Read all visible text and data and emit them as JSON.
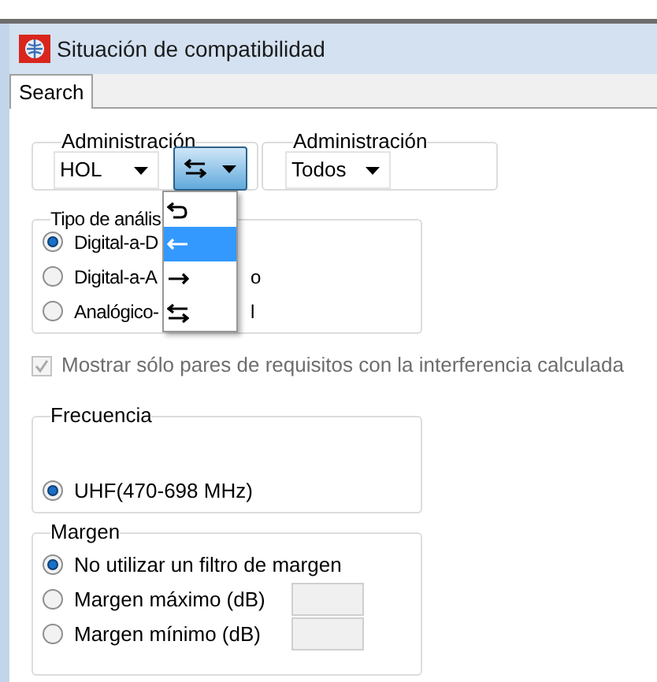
{
  "window": {
    "title": "Situación de compatibilidad"
  },
  "tabs": [
    {
      "label": "Search",
      "selected": true
    }
  ],
  "admin_groups": [
    {
      "label": "Administración",
      "value": "HOL"
    },
    {
      "label": "Administración",
      "value": "Todos"
    }
  ],
  "direction_combo": {
    "kind": "swap",
    "expanded": true,
    "options": [
      {
        "kind": "undo",
        "selected": false
      },
      {
        "kind": "left",
        "selected": true
      },
      {
        "kind": "right",
        "selected": false
      },
      {
        "kind": "swap",
        "selected": false
      }
    ]
  },
  "analysis_type": {
    "label": "Tipo de anális",
    "options": [
      {
        "label": "Digital-a-D",
        "selected": true
      },
      {
        "label": "Digital-a-A",
        "tail": "o",
        "selected": false
      },
      {
        "label": "Analógico-",
        "tail": "l",
        "selected": false
      }
    ]
  },
  "show_only_checkbox": {
    "label": "Mostrar sólo pares de requisitos con la interferencia calculada",
    "checked": true,
    "disabled": true
  },
  "frequency": {
    "label": "Frecuencia",
    "options": [
      {
        "label": "UHF(470-698 MHz)",
        "selected": true
      }
    ]
  },
  "margin": {
    "label": "Margen",
    "options": [
      {
        "label": "No utilizar un filtro de margen",
        "selected": true,
        "has_field": false
      },
      {
        "label": "Margen máximo (dB)",
        "selected": false,
        "has_field": true
      },
      {
        "label": "Margen mínimo (dB)",
        "selected": false,
        "has_field": true
      }
    ]
  }
}
